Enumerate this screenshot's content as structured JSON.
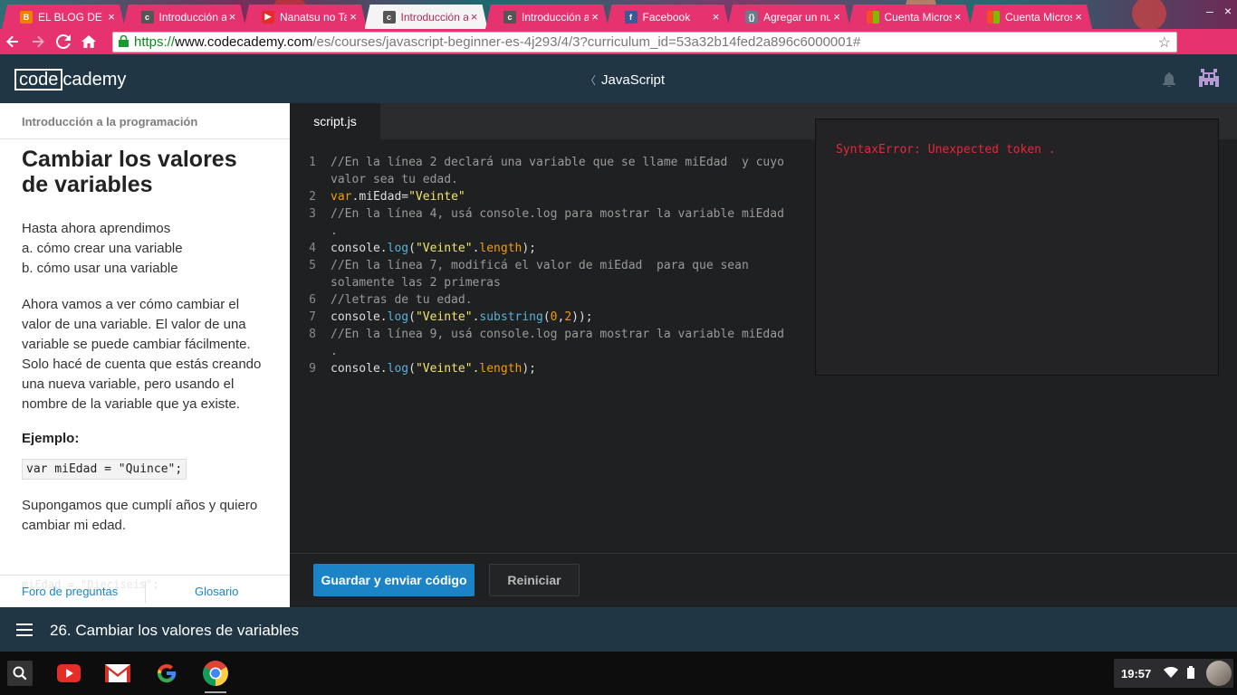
{
  "browser": {
    "tabs": [
      {
        "title": "EL BLOG DE LA",
        "favicon": "blogger-icon",
        "active": false
      },
      {
        "title": "Introducción a",
        "favicon": "codecademy-icon",
        "active": false
      },
      {
        "title": "Nanatsu no Ta",
        "favicon": "youtube-icon",
        "active": false
      },
      {
        "title": "Introducción a",
        "favicon": "codecademy-icon",
        "active": true
      },
      {
        "title": "Introducción a",
        "favicon": "codecademy-icon",
        "active": false
      },
      {
        "title": "Facebook",
        "favicon": "facebook-icon",
        "active": false
      },
      {
        "title": "Agregar un nu",
        "favicon": "code-icon",
        "active": false
      },
      {
        "title": "Cuenta Micros",
        "favicon": "microsoft-icon",
        "active": false
      },
      {
        "title": "Cuenta Micros",
        "favicon": "microsoft-icon",
        "active": false
      }
    ],
    "tab_close": "×",
    "window_controls": {
      "minimize": "–",
      "close": "×"
    },
    "url": {
      "scheme": "https://",
      "host": "www.codecademy.com",
      "path": "/es/courses/javascript-beginner-es-4j293/4/3?curriculum_id=53a32b14fed2a896c6000001#"
    },
    "colors": {
      "theme": "#e6326e"
    }
  },
  "header": {
    "logo_box": "code",
    "logo_rest": "cademy",
    "course": "JavaScript",
    "chevron": "〈"
  },
  "lesson": {
    "breadcrumb": "Introducción a la programación",
    "title": "Cambiar los valores de variables",
    "intro": [
      "Hasta ahora aprendimos",
      "a. cómo crear una variable",
      "b. cómo usar una variable"
    ],
    "paragraph": "Ahora vamos a ver cómo cambiar el valor de una variable. El valor de una variable se puede cambiar fácilmente. Solo hacé de cuenta que estás creando una nueva variable, pero usando el nombre de la variable que ya existe.",
    "example_label": "Ejemplo:",
    "example_code": "var miEdad = \"Quince\";",
    "after_example": "Supongamos que cumplí años y quiero cambiar mi edad.",
    "ghost_code": "miEdad = \"Dieciseis\";",
    "footer": {
      "forum": "Foro de preguntas",
      "glossary": "Glosario"
    }
  },
  "editor": {
    "file_tab": "script.js",
    "line_numbers": [
      "1",
      "2",
      "3",
      "4",
      "5",
      "6",
      "7",
      "8",
      "9"
    ],
    "lines": [
      [
        [
          "cm",
          "//En la línea 2 declará una variable que se llame miEdad  y cuyo valor sea tu edad."
        ]
      ],
      [
        [
          "kw",
          "var"
        ],
        [
          "pl",
          "."
        ],
        [
          "pl",
          "miEdad="
        ],
        [
          "str",
          "\"Veinte\""
        ]
      ],
      [
        [
          "cm",
          "//En la línea 4, usá console.log para mostrar la variable miEdad ."
        ]
      ],
      [
        [
          "pl",
          "console."
        ],
        [
          "fn",
          "log"
        ],
        [
          "pl",
          "("
        ],
        [
          "str",
          "\"Veinte\""
        ],
        [
          "pl",
          "."
        ],
        [
          "kw",
          "length"
        ],
        [
          "pl",
          ");"
        ]
      ],
      [
        [
          "cm",
          "//En la línea 7, modificá el valor de miEdad  para que sean solamente las 2 primeras"
        ]
      ],
      [
        [
          "cm",
          "//letras de tu edad."
        ]
      ],
      [
        [
          "pl",
          "console."
        ],
        [
          "fn",
          "log"
        ],
        [
          "pl",
          "("
        ],
        [
          "str",
          "\"Veinte\""
        ],
        [
          "pl",
          "."
        ],
        [
          "fn",
          "substring"
        ],
        [
          "pl",
          "("
        ],
        [
          "num",
          "0"
        ],
        [
          "pl",
          ","
        ],
        [
          "num",
          "2"
        ],
        [
          "pl",
          "));"
        ]
      ],
      [
        [
          "cm",
          "//En la línea 9, usá console.log para mostrar la variable miEdad ."
        ]
      ],
      [
        [
          "pl",
          "console."
        ],
        [
          "fn",
          "log"
        ],
        [
          "pl",
          "("
        ],
        [
          "str",
          "\"Veinte\""
        ],
        [
          "pl",
          "."
        ],
        [
          "kw",
          "length"
        ],
        [
          "pl",
          ");"
        ]
      ]
    ],
    "console_output": "SyntaxError: Unexpected token ."
  },
  "actions": {
    "submit": "Guardar y enviar código",
    "reset": "Reiniciar"
  },
  "lesson_nav": {
    "title": "26. Cambiar los valores de variables"
  },
  "shelf": {
    "apps": [
      "youtube-icon",
      "gmail-icon",
      "google-icon",
      "chrome-icon"
    ],
    "time": "19:57"
  }
}
